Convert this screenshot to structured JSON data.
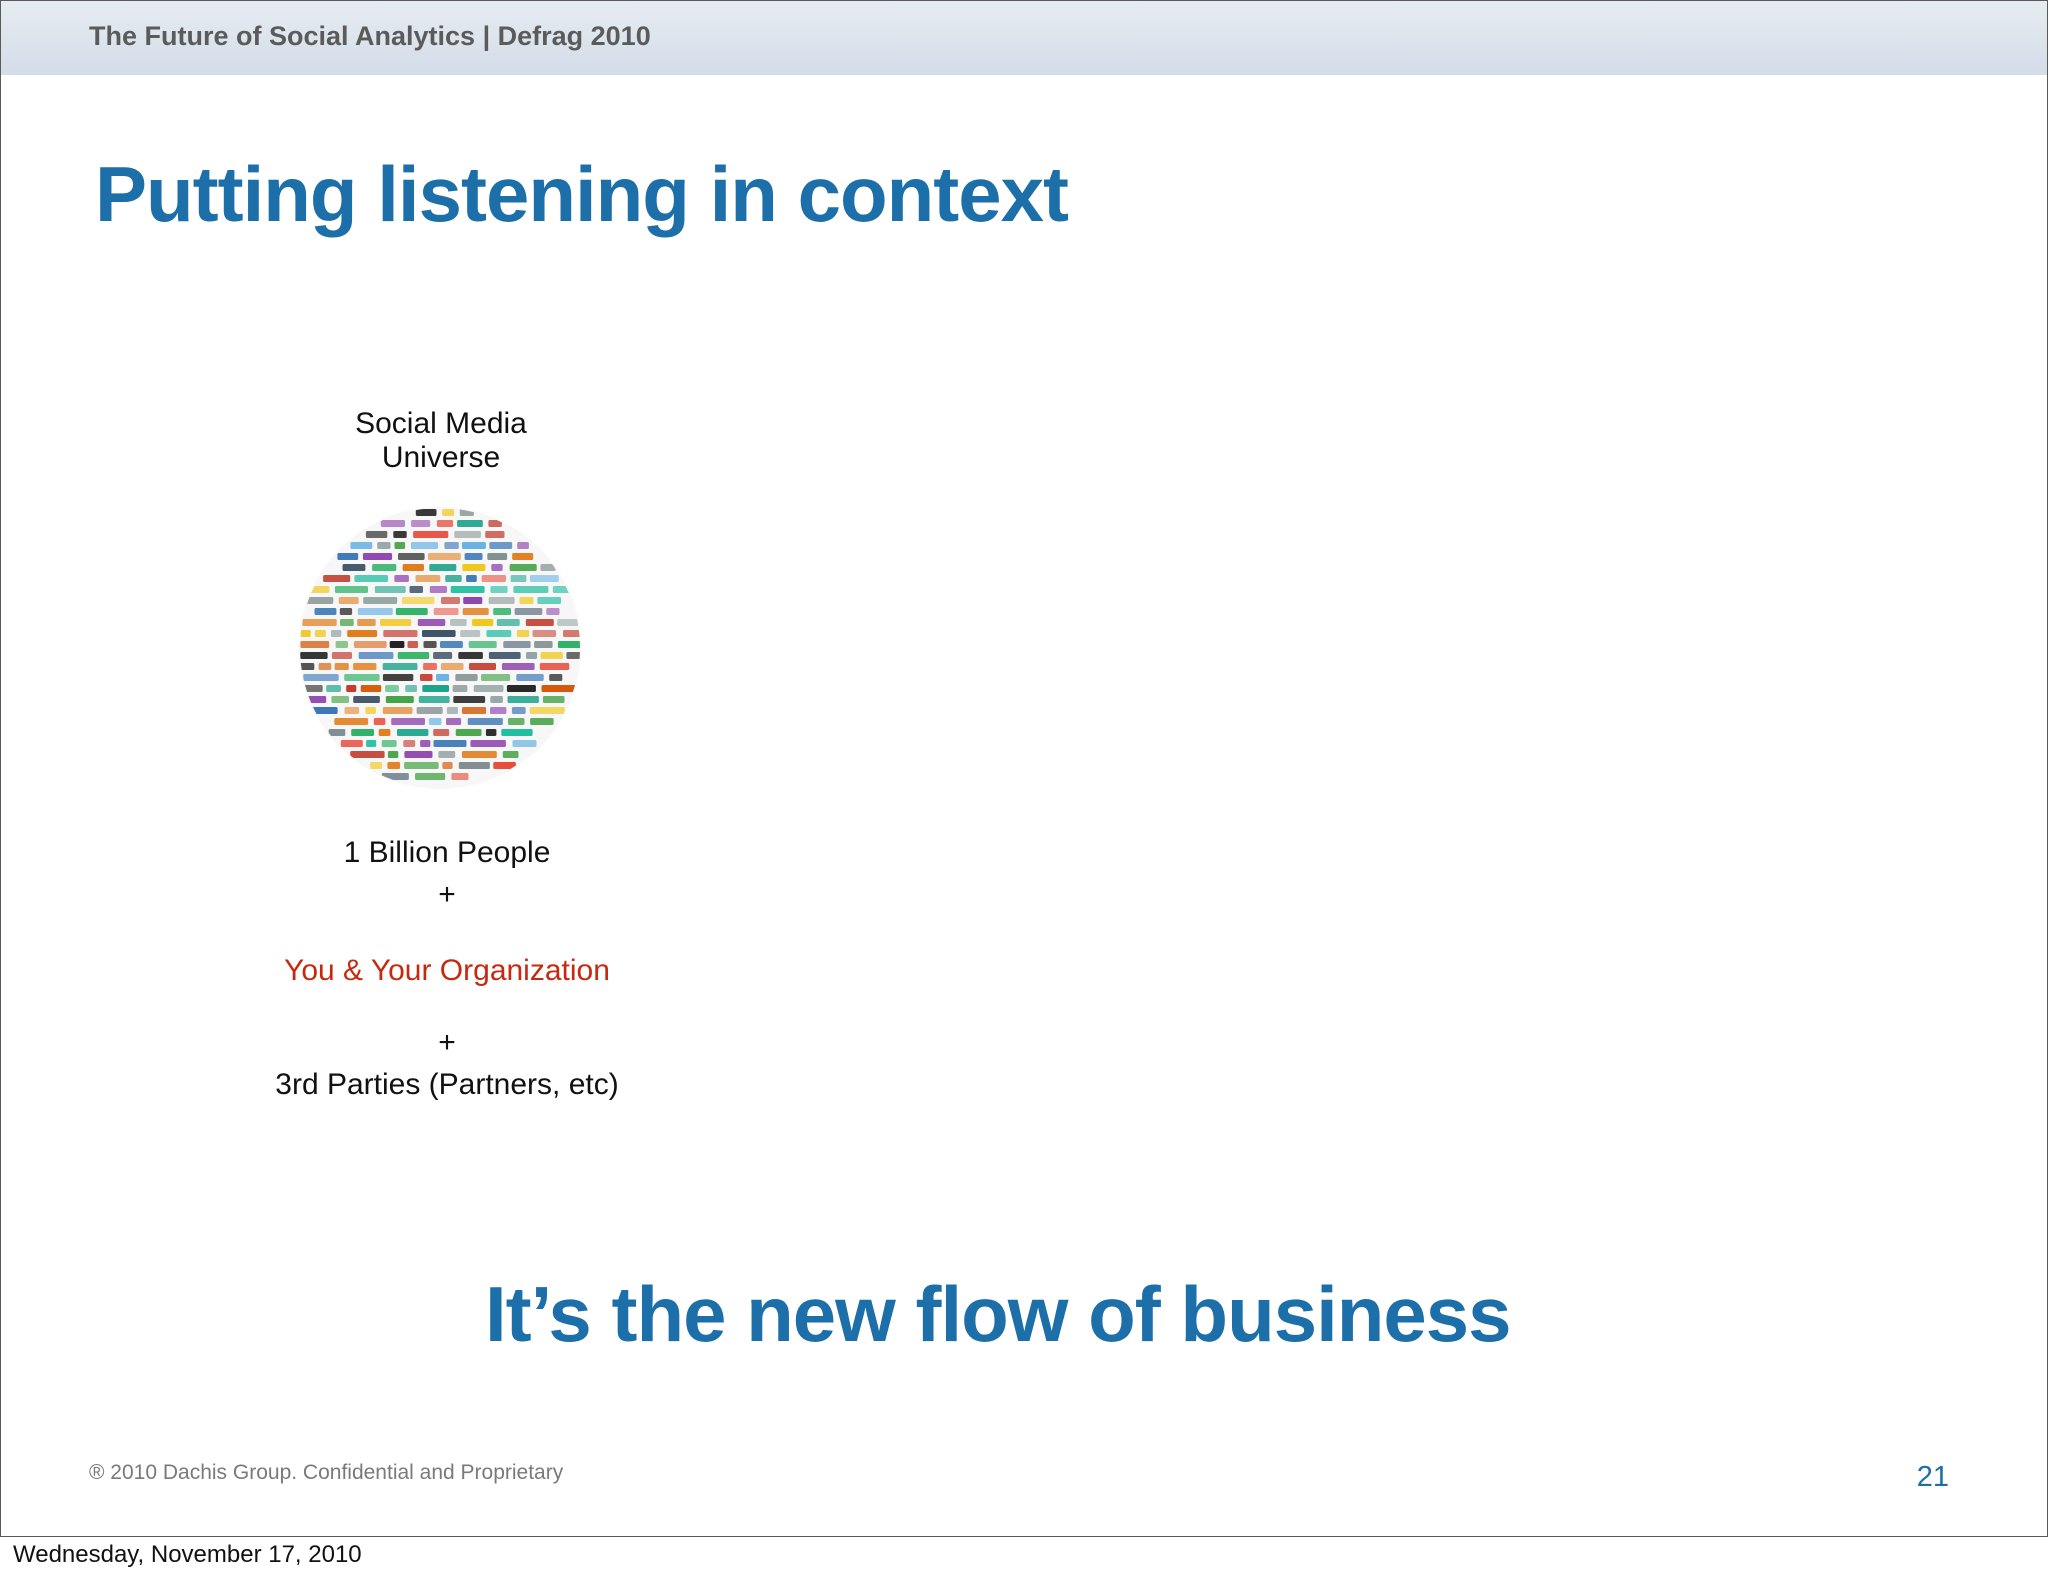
{
  "header": {
    "title": "The Future of Social Analytics | Defrag 2010"
  },
  "slide": {
    "title": "Putting listening in context",
    "universe_label_line1": "Social Media",
    "universe_label_line2": "Universe",
    "image_description": "social-media-logos-sphere",
    "people": "1 Billion People",
    "plus1": "+",
    "organization": "You & Your Organization",
    "plus2": "+",
    "third_parties": "3rd Parties (Partners, etc)",
    "tagline": "It’s the new flow of business"
  },
  "footer": {
    "copyright": "® 2010 Dachis Group. Confidential and Proprietary",
    "page_number": "21"
  },
  "date": "Wednesday, November 17, 2010",
  "colors": {
    "title_blue": "#1c6fa8",
    "accent_red": "#c52a10",
    "header_band": "#d9e2ec"
  }
}
